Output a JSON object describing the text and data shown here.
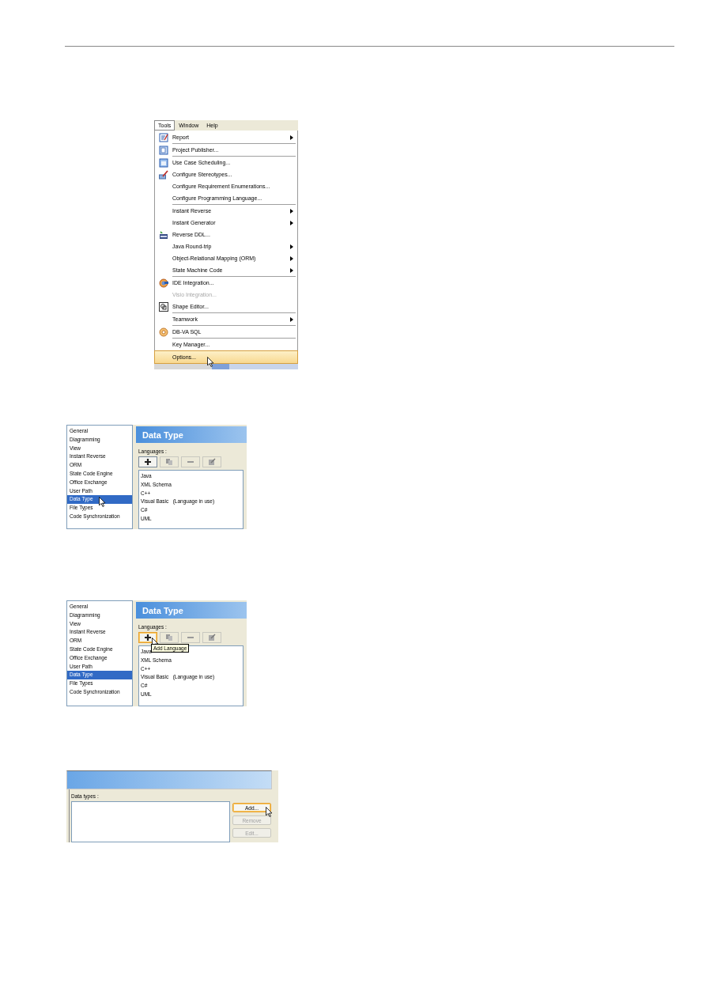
{
  "menu_screenshot": {
    "menubar": [
      {
        "label": "Tools",
        "selected": true
      },
      {
        "label": "Window",
        "selected": false
      },
      {
        "label": "Help",
        "selected": false
      }
    ],
    "groups": [
      [
        {
          "label": "Report",
          "kind": "report",
          "submenu": true,
          "disabled": false,
          "selected": false
        }
      ],
      [
        {
          "label": "Project Publisher...",
          "kind": "publisher",
          "submenu": false,
          "disabled": false,
          "selected": false
        }
      ],
      [
        {
          "label": "Use Case Scheduling...",
          "kind": "schedule",
          "submenu": false,
          "disabled": false,
          "selected": false
        },
        {
          "label": "Configure Stereotypes...",
          "kind": "stereotype",
          "submenu": false,
          "disabled": false,
          "selected": false
        },
        {
          "label": "Configure Requirement Enumerations...",
          "submenu": false,
          "disabled": false,
          "selected": false
        },
        {
          "label": "Configure Programming Language...",
          "submenu": false,
          "disabled": false,
          "selected": false
        }
      ],
      [
        {
          "label": "Instant Reverse",
          "submenu": true,
          "disabled": false,
          "selected": false
        },
        {
          "label": "Instant Generator",
          "submenu": true,
          "disabled": false,
          "selected": false
        },
        {
          "label": "Reverse DDL...",
          "kind": "ddl",
          "submenu": false,
          "disabled": false,
          "selected": false
        },
        {
          "label": "Java Round-trip",
          "submenu": true,
          "disabled": false,
          "selected": false
        },
        {
          "label": "Object-Relational Mapping (ORM)",
          "submenu": true,
          "disabled": false,
          "selected": false
        },
        {
          "label": "State Machine Code",
          "submenu": true,
          "disabled": false,
          "selected": false
        }
      ],
      [
        {
          "label": "IDE Integration...",
          "kind": "ide",
          "submenu": false,
          "disabled": false,
          "selected": false
        },
        {
          "label": "Visio Integration...",
          "submenu": false,
          "disabled": true,
          "selected": false
        },
        {
          "label": "Shape Editor...",
          "kind": "shape",
          "submenu": false,
          "disabled": false,
          "selected": false
        }
      ],
      [
        {
          "label": "Teamwork",
          "submenu": true,
          "disabled": false,
          "selected": false
        }
      ],
      [
        {
          "label": "DB-VA SQL",
          "kind": "db",
          "submenu": false,
          "disabled": false,
          "selected": false
        }
      ],
      [
        {
          "label": "Key Manager...",
          "submenu": false,
          "disabled": false,
          "selected": false
        }
      ],
      [
        {
          "label": "Options...",
          "submenu": false,
          "disabled": false,
          "selected": true
        }
      ]
    ]
  },
  "options_screenshots": [
    {
      "categories": [
        {
          "label": "General",
          "selected": false
        },
        {
          "label": "Diagramming",
          "selected": false
        },
        {
          "label": "View",
          "selected": false
        },
        {
          "label": "Instant Reverse",
          "selected": false
        },
        {
          "label": "ORM",
          "selected": false
        },
        {
          "label": "State Code Engine",
          "selected": false
        },
        {
          "label": "Office Exchange",
          "selected": false
        },
        {
          "label": "User Path",
          "selected": false
        },
        {
          "label": "Data Type",
          "selected": true
        },
        {
          "label": "File Types",
          "selected": false
        },
        {
          "label": "Code Synchronization",
          "selected": false
        }
      ],
      "title": "Data Type",
      "languages_label": "Languages :",
      "tools": [
        {
          "kind": "add",
          "disabled": false,
          "hovered": false
        },
        {
          "kind": "copy",
          "disabled": true,
          "hovered": false
        },
        {
          "kind": "remove",
          "disabled": true,
          "hovered": false
        },
        {
          "kind": "edit",
          "disabled": true,
          "hovered": false
        }
      ],
      "languages": [
        "Java",
        "XML Schema",
        "C++",
        "Visual Basic   (Language in use)",
        "C#",
        "UML"
      ]
    },
    {
      "categories": [
        {
          "label": "General",
          "selected": false
        },
        {
          "label": "Diagramming",
          "selected": false
        },
        {
          "label": "View",
          "selected": false
        },
        {
          "label": "Instant Reverse",
          "selected": false
        },
        {
          "label": "ORM",
          "selected": false
        },
        {
          "label": "State Code Engine",
          "selected": false
        },
        {
          "label": "Office Exchange",
          "selected": false
        },
        {
          "label": "User Path",
          "selected": false
        },
        {
          "label": "Data Type",
          "selected": true
        },
        {
          "label": "File Types",
          "selected": false
        },
        {
          "label": "Code Synchronization",
          "selected": false
        }
      ],
      "title": "Data Type",
      "languages_label": "Languages :",
      "tools": [
        {
          "kind": "add",
          "disabled": false,
          "hovered": true
        },
        {
          "kind": "copy",
          "disabled": true,
          "hovered": false
        },
        {
          "kind": "remove",
          "disabled": true,
          "hovered": false
        },
        {
          "kind": "edit",
          "disabled": true,
          "hovered": false
        }
      ],
      "languages": [
        "Java",
        "XML Schema",
        "C++",
        "Visual Basic   (Language in use)",
        "C#",
        "UML"
      ],
      "tooltip": "Add Language"
    }
  ],
  "data_types_screenshot": {
    "list_label": "Data types :",
    "buttons": [
      {
        "label": "Add...",
        "disabled": false,
        "hovered": true
      },
      {
        "label": "Remove",
        "disabled": true,
        "hovered": false
      },
      {
        "label": "Edit...",
        "disabled": true,
        "hovered": false
      }
    ]
  }
}
